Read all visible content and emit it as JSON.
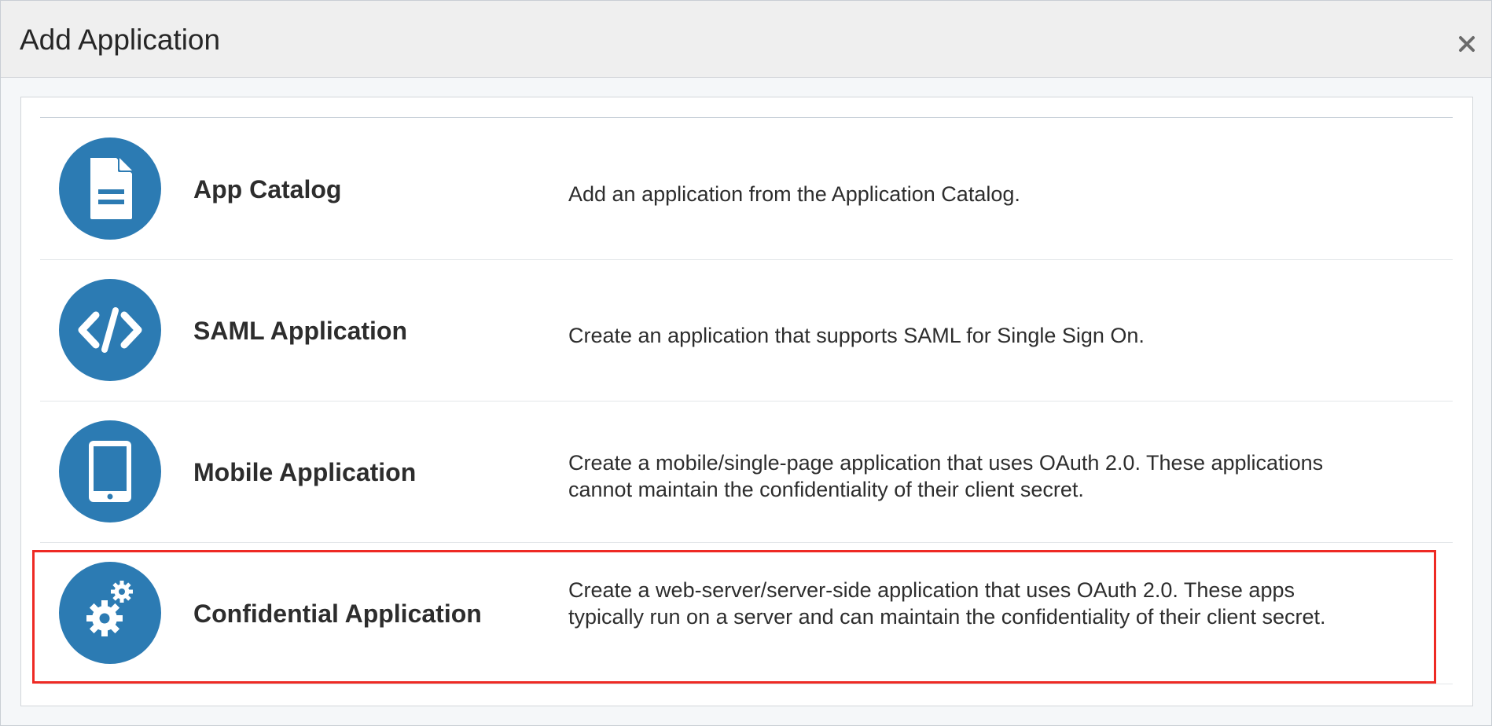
{
  "dialog": {
    "title": "Add Application",
    "close_icon": "close-icon"
  },
  "options": [
    {
      "icon": "document-icon",
      "title": "App Catalog",
      "description": "Add an application from the Application Catalog."
    },
    {
      "icon": "code-icon",
      "title": "SAML Application",
      "description": "Create an application that supports SAML for Single Sign On."
    },
    {
      "icon": "tablet-icon",
      "title": "Mobile Application",
      "description": "Create a mobile/single-page application that uses OAuth 2.0. These applications cannot maintain the confidentiality of their client secret."
    },
    {
      "icon": "gears-icon",
      "title": "Confidential Application",
      "description": "Create a web-server/server-side application that uses OAuth 2.0. These apps typically run on a server and can maintain the confidentiality of their client secret."
    }
  ],
  "colors": {
    "icon_circle": "#2c7bb3",
    "highlight_border": "#ee2a24",
    "header_background": "#efefef"
  }
}
